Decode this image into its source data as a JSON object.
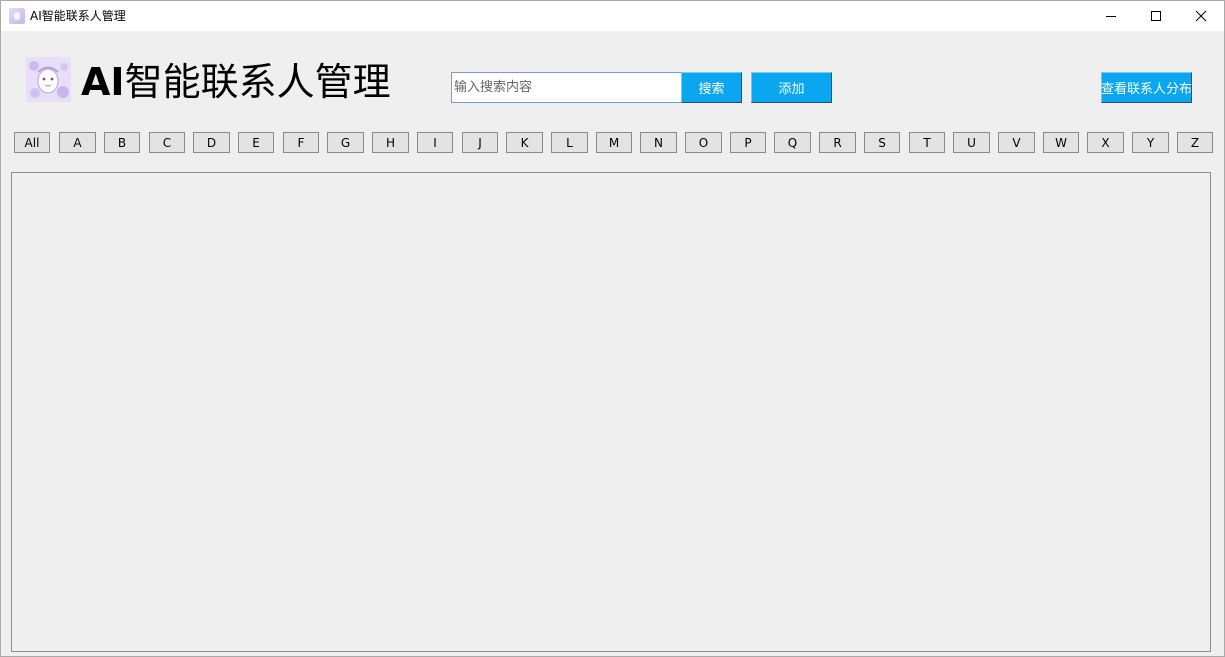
{
  "window": {
    "title": "AI智能联系人管理"
  },
  "header": {
    "title_prefix": "AI",
    "title_main": "智能联系人管理",
    "logo_icon": "anime-character-icon"
  },
  "search": {
    "placeholder": "输入搜索内容",
    "value": "",
    "search_label": "搜索",
    "add_label": "添加"
  },
  "distribution_button": {
    "label": "查看联系人分布"
  },
  "letters": [
    "All",
    "A",
    "B",
    "C",
    "D",
    "E",
    "F",
    "G",
    "H",
    "I",
    "J",
    "K",
    "L",
    "M",
    "N",
    "O",
    "P",
    "Q",
    "R",
    "S",
    "T",
    "U",
    "V",
    "W",
    "X",
    "Y",
    "Z"
  ],
  "colors": {
    "accent": "#0aa6f0",
    "background": "#efefef"
  }
}
